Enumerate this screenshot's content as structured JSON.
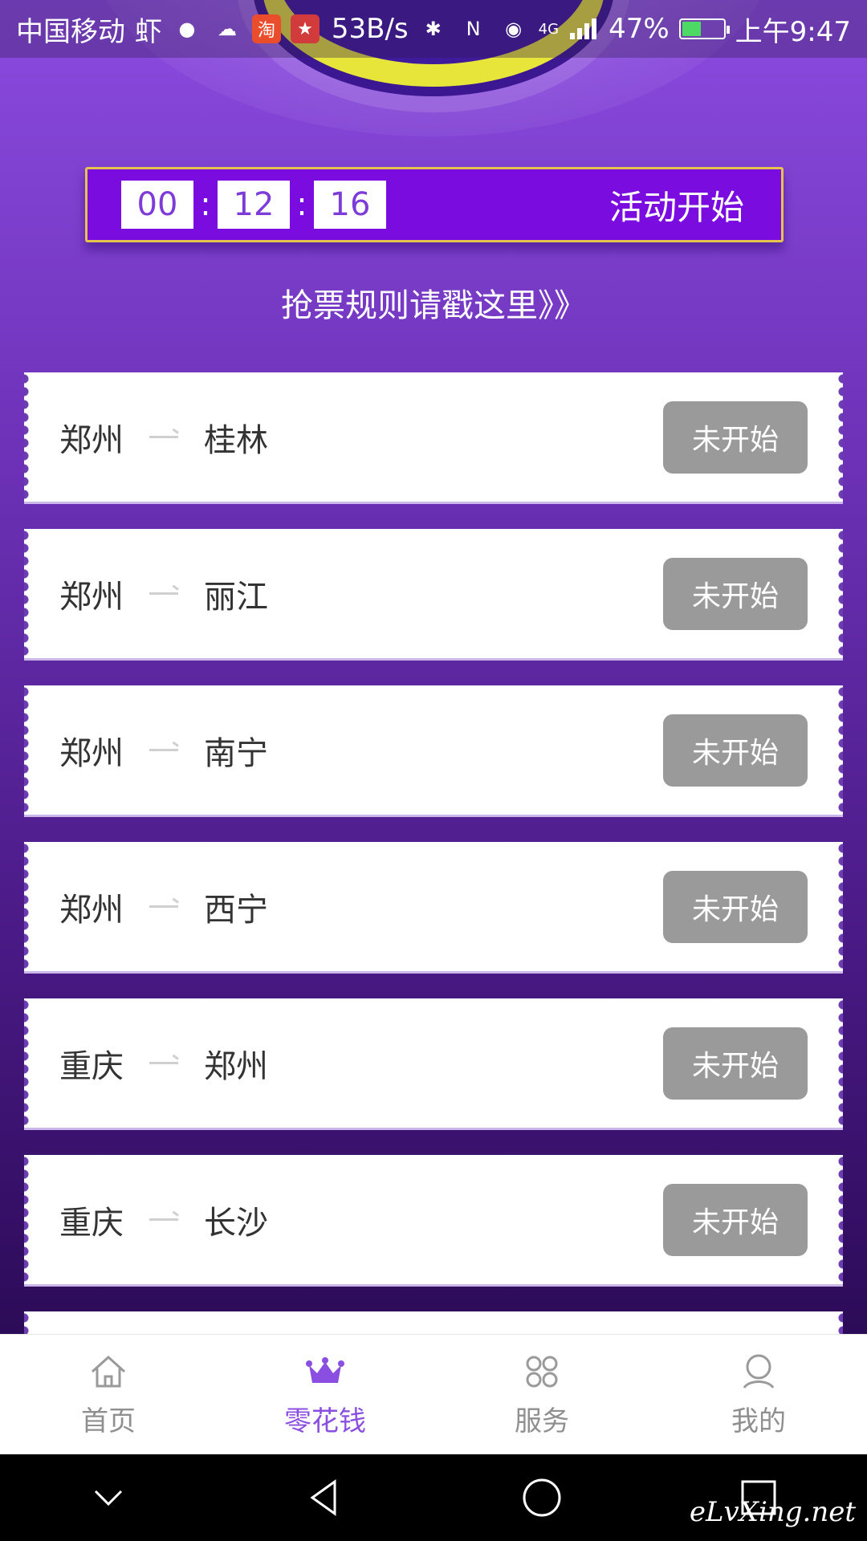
{
  "status_bar": {
    "carrier": "中国移动",
    "carrier_extra": "虾",
    "speed": "53B/s",
    "network": "4G",
    "battery": "47%",
    "battery_level": 0.47,
    "time": "上午9:47"
  },
  "countdown": {
    "hours": "00",
    "minutes": "12",
    "seconds": "16",
    "sep": ":",
    "label": "活动开始"
  },
  "rules_link": "抢票规则请戳这里》》",
  "routes": [
    {
      "from": "郑州",
      "to": "桂林",
      "status": "未开始"
    },
    {
      "from": "郑州",
      "to": "丽江",
      "status": "未开始"
    },
    {
      "from": "郑州",
      "to": "南宁",
      "status": "未开始"
    },
    {
      "from": "郑州",
      "to": "西宁",
      "status": "未开始"
    },
    {
      "from": "重庆",
      "to": "郑州",
      "status": "未开始"
    },
    {
      "from": "重庆",
      "to": "长沙",
      "status": "未开始"
    }
  ],
  "tabs": [
    {
      "label": "首页",
      "icon": "home-icon"
    },
    {
      "label": "零花钱",
      "icon": "crown-icon",
      "active": true
    },
    {
      "label": "服务",
      "icon": "grid-icon"
    },
    {
      "label": "我的",
      "icon": "user-icon"
    }
  ],
  "watermark": "eLvXing.net",
  "colors": {
    "accent": "#8a4fe0",
    "countdown_bg": "#7a0ce0",
    "countdown_border": "#e6c34c",
    "button_disabled": "#9a9a9a"
  }
}
